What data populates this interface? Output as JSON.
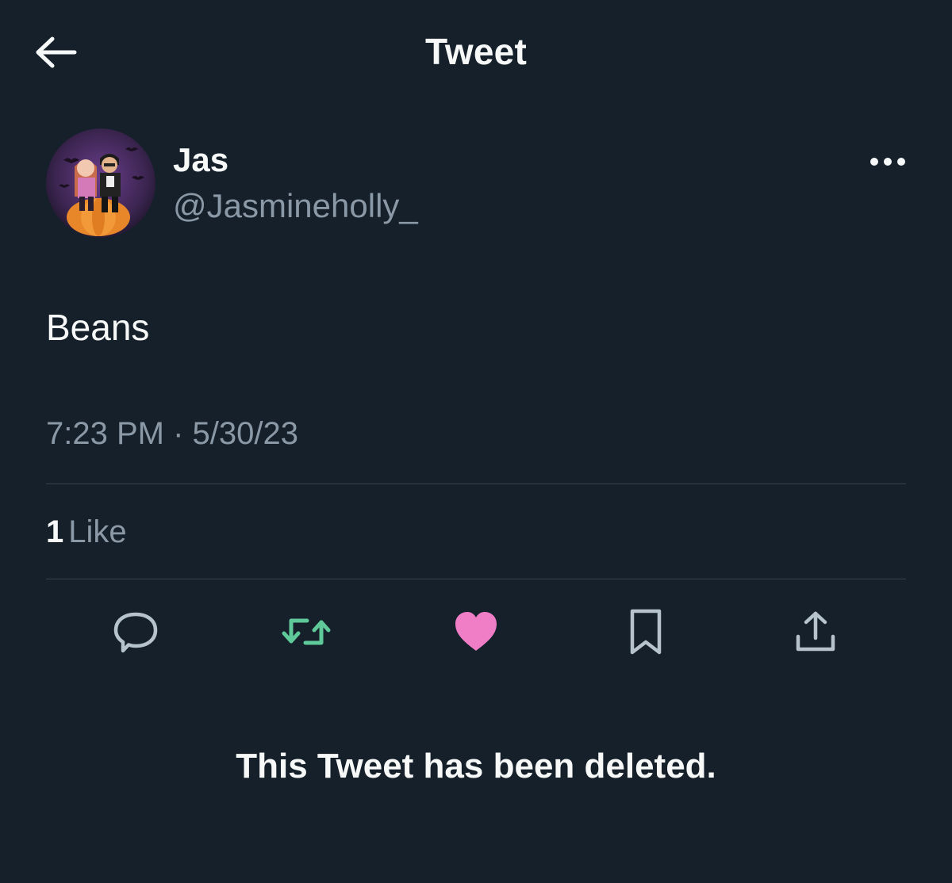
{
  "header": {
    "title": "Tweet"
  },
  "author": {
    "display_name": "Jas",
    "handle": "@Jasmineholly_"
  },
  "tweet": {
    "text": "Beans",
    "timestamp": "7:23 PM · 5/30/23"
  },
  "stats": {
    "likes_count": "1",
    "likes_label": "Like"
  },
  "deleted_notice": "This Tweet has been deleted.",
  "colors": {
    "background": "#15202b",
    "primary_text": "#f7f9f9",
    "secondary_text": "#8b98a5",
    "divider": "#38444d",
    "icon_gray": "#8b98a5",
    "retweet_green": "#5fc99a",
    "like_pink": "#f07ec6",
    "moon_yellow": "#f5c84a"
  },
  "icons": {
    "back": "arrow-left-icon",
    "more": "more-horizontal-icon",
    "reply": "reply-icon",
    "retweet": "retweet-icon",
    "like": "heart-icon",
    "bookmark": "bookmark-icon",
    "share": "share-icon",
    "name_emoji": "crescent-moon-icon"
  }
}
